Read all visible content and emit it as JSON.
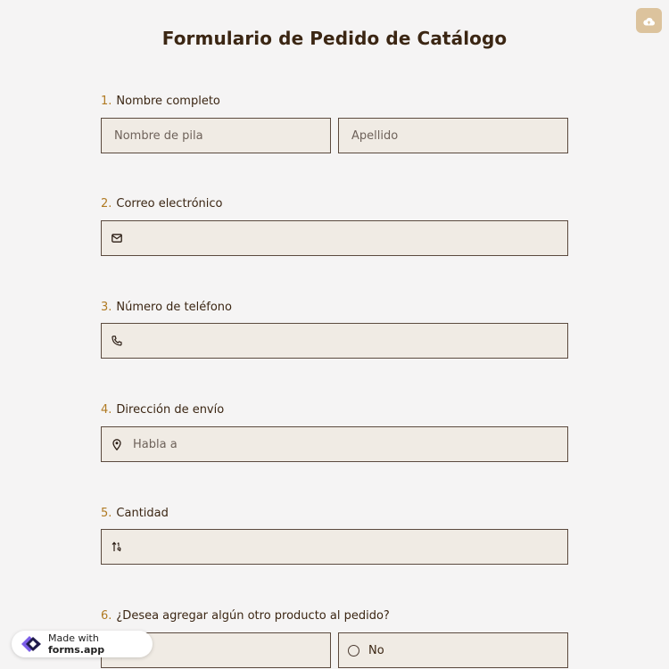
{
  "form": {
    "title": "Formulario de Pedido de Catálogo"
  },
  "toolbar": {
    "save_icon": "cloud-upload-icon"
  },
  "questions": [
    {
      "number": "1.",
      "label": "Nombre completo",
      "fields": [
        {
          "placeholder": "Nombre de pila",
          "icon": ""
        },
        {
          "placeholder": "Apellido",
          "icon": ""
        }
      ]
    },
    {
      "number": "2.",
      "label": "Correo electrónico",
      "fields": [
        {
          "placeholder": "",
          "icon": "envelope-icon"
        }
      ]
    },
    {
      "number": "3.",
      "label": "Número de teléfono",
      "fields": [
        {
          "placeholder": "",
          "icon": "phone-icon"
        }
      ]
    },
    {
      "number": "4.",
      "label": "Dirección de envío",
      "fields": [
        {
          "placeholder": "Habla a",
          "icon": "map-pin-icon"
        }
      ]
    },
    {
      "number": "5.",
      "label": "Cantidad",
      "fields": [
        {
          "placeholder": "",
          "icon": "number-sort-icon"
        }
      ]
    },
    {
      "number": "6.",
      "label": "¿Desea agregar algún otro producto al pedido?",
      "options": [
        "No"
      ]
    }
  ],
  "badge": {
    "made_with": "Made with ",
    "brand": "forms.app"
  },
  "colors": {
    "background": "#f5f4f4",
    "field_bg": "#f0ebe4",
    "field_border": "#5b4a3e",
    "number_accent": "#b07a22",
    "title_text": "#3b2613",
    "cloud_button": "#dcc39d"
  }
}
